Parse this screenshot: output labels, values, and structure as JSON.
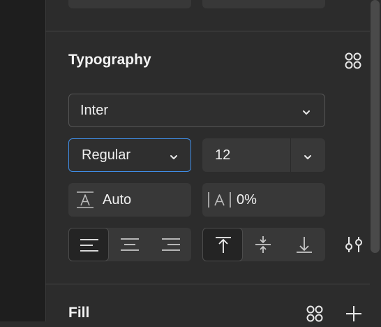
{
  "typography": {
    "title": "Typography",
    "font_family": "Inter",
    "font_style": "Regular",
    "font_size": "12",
    "line_height": "Auto",
    "letter_spacing": "0%",
    "text_align": [
      "left",
      "center",
      "right"
    ],
    "text_align_selected": "left",
    "vertical_align": [
      "top",
      "middle",
      "bottom"
    ],
    "vertical_align_selected": "top"
  },
  "fill": {
    "title": "Fill"
  },
  "icons": {
    "styles": "four-dots-icon",
    "settings": "sliders-icon",
    "add": "plus-icon",
    "dropdown": "chevron-down-icon",
    "line_height": "line-height-icon",
    "letter_spacing": "letter-spacing-icon"
  },
  "colors": {
    "panel": "#2c2c2c",
    "field": "#383838",
    "focus": "#3f8de6"
  }
}
